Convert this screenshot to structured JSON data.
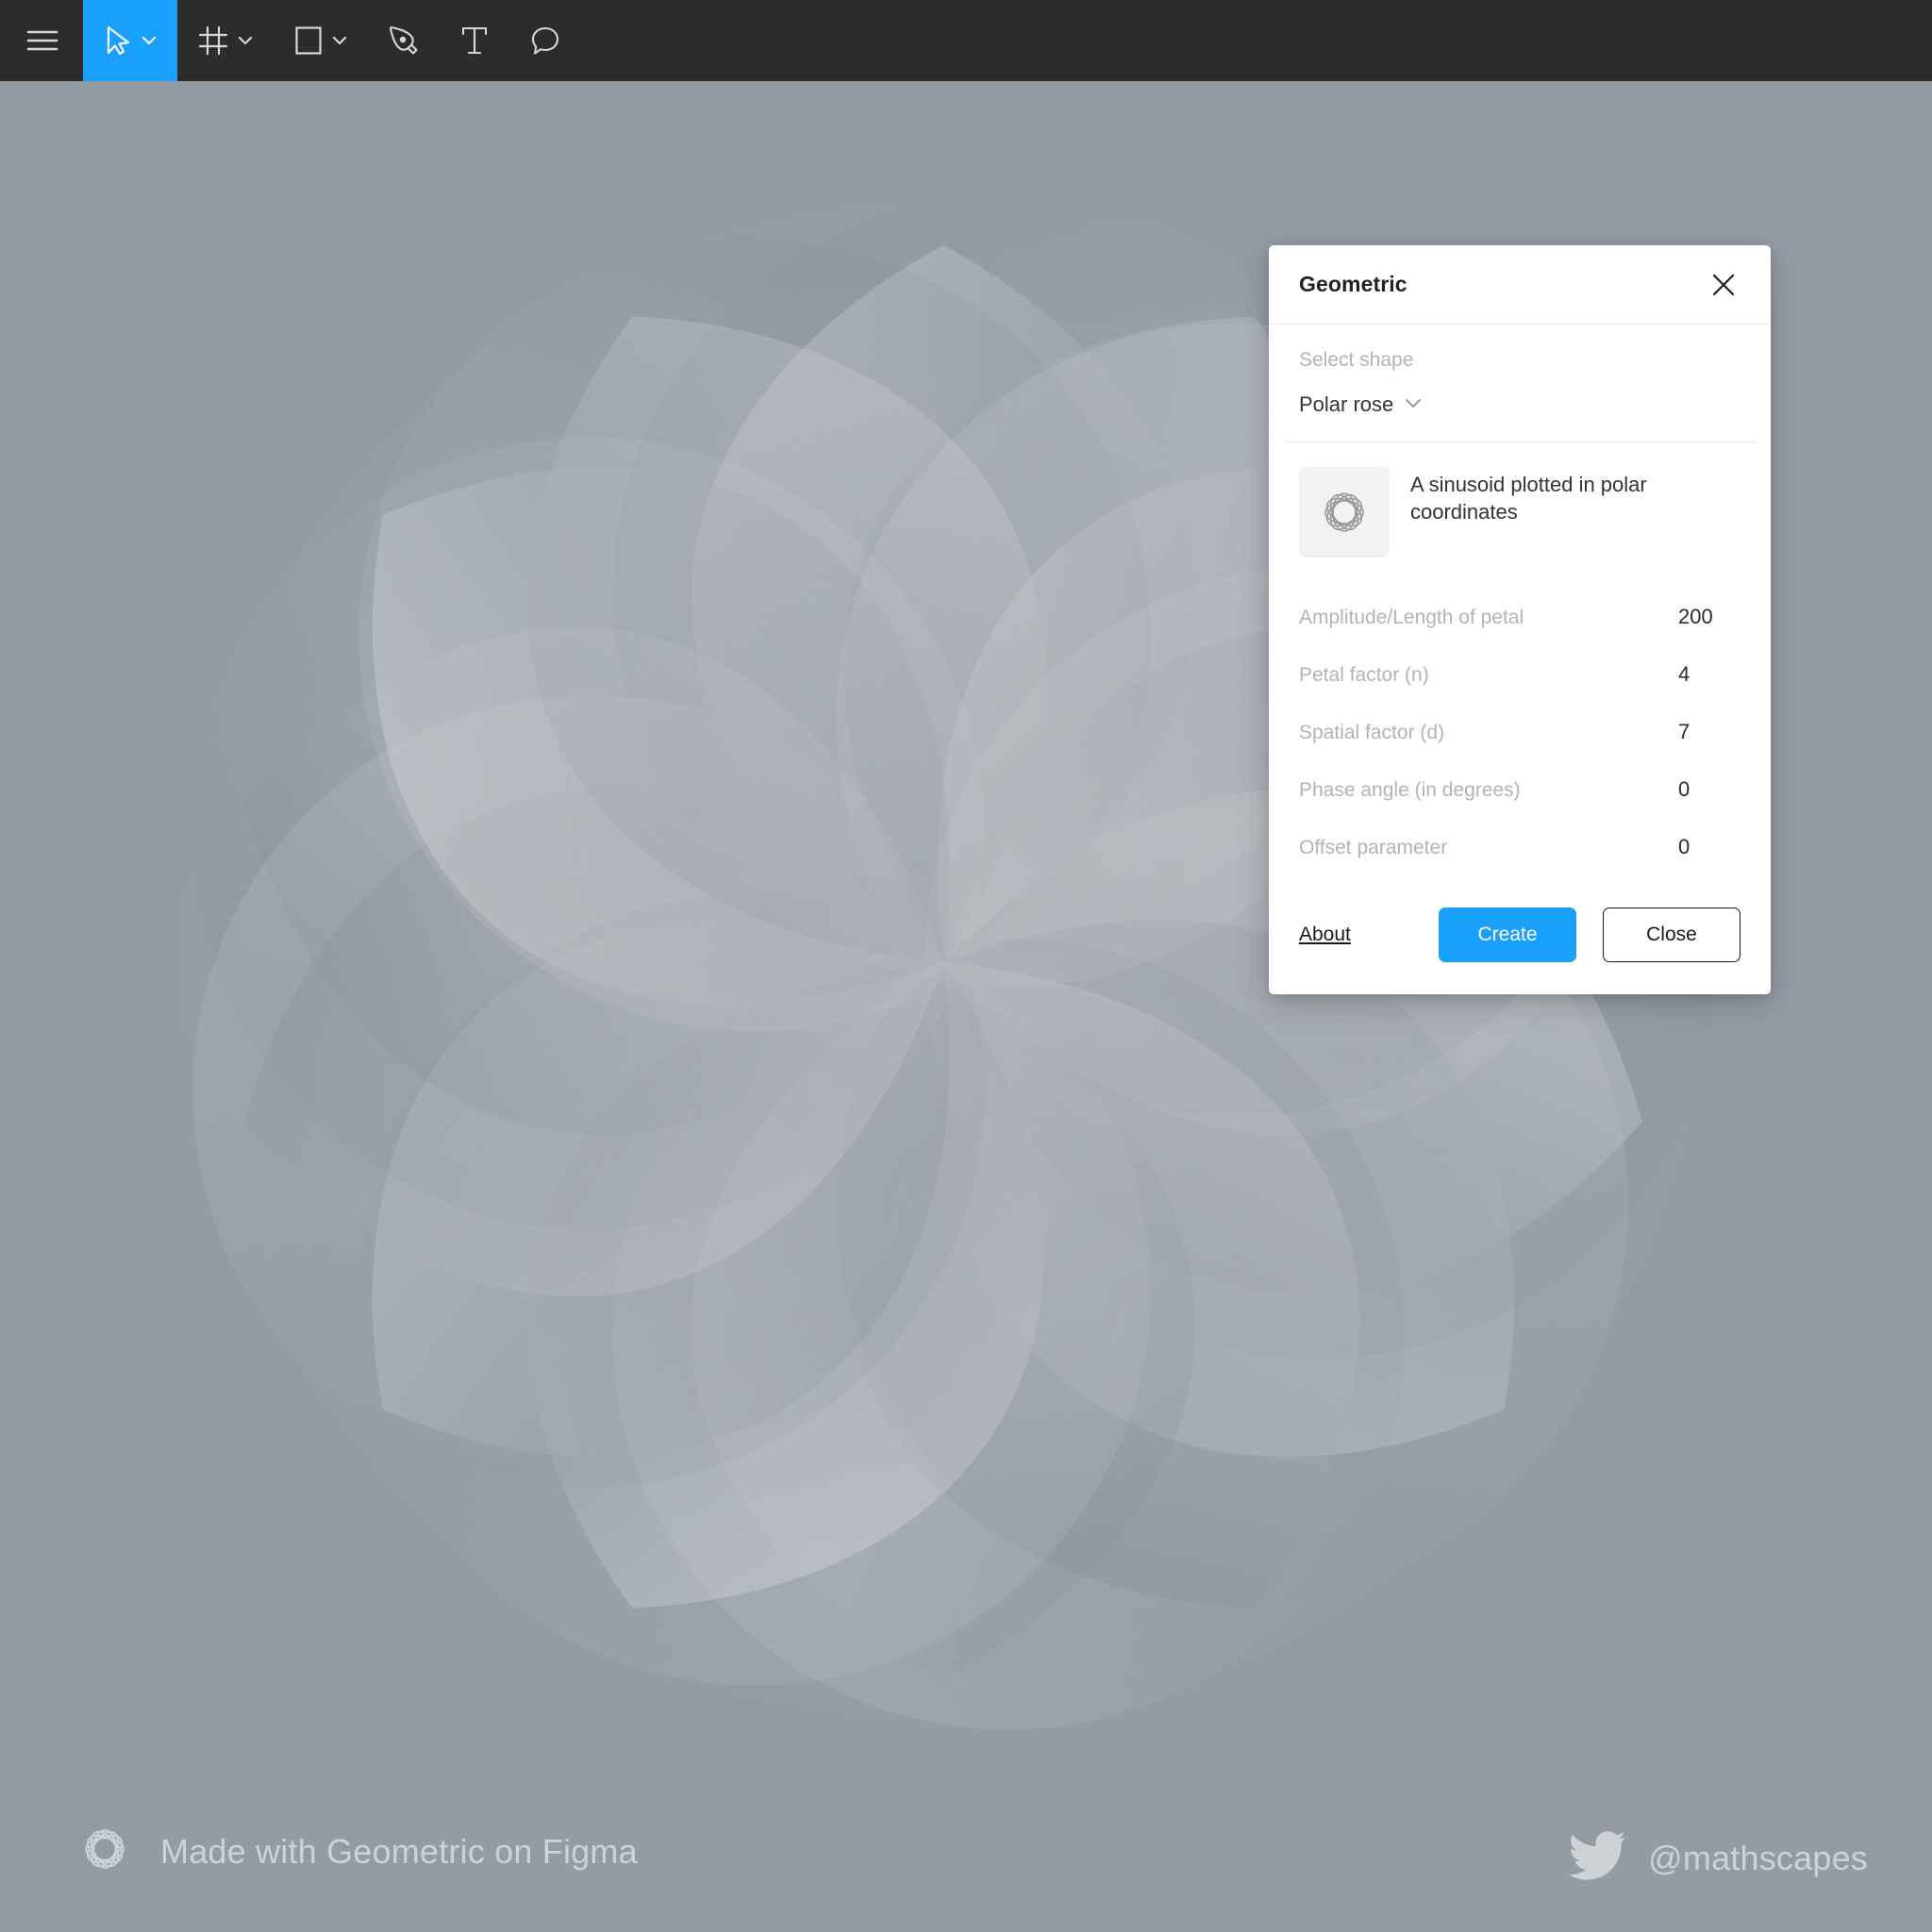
{
  "app": {
    "canvas_background": "#939ca5",
    "accent": "#18a0fb",
    "toolbar_background": "#2c2c2c"
  },
  "toolbar": {
    "items": [
      {
        "name": "main-menu",
        "icon": "hamburger-menu-icon",
        "has_chevron": false,
        "active": false
      },
      {
        "name": "move-tool",
        "icon": "cursor-arrow-icon",
        "has_chevron": true,
        "active": true
      },
      {
        "name": "frame-tool",
        "icon": "frame-grid-icon",
        "has_chevron": true,
        "active": false
      },
      {
        "name": "shape-tool",
        "icon": "rectangle-icon",
        "has_chevron": true,
        "active": false
      },
      {
        "name": "pen-tool",
        "icon": "pen-nib-icon",
        "has_chevron": false,
        "active": false
      },
      {
        "name": "text-tool",
        "icon": "text-t-icon",
        "has_chevron": false,
        "active": false
      },
      {
        "name": "comment-tool",
        "icon": "comment-bubble-icon",
        "has_chevron": false,
        "active": false
      }
    ]
  },
  "dialog": {
    "title": "Geometric",
    "close_icon": "close-x-icon",
    "select_shape_label": "Select shape",
    "selected_shape": "Polar rose",
    "shape_chevron_icon": "chevron-down-icon",
    "preview_icon": "polar-rose-rosette-icon",
    "description": "A sinusoid plotted in polar coordinates",
    "parameters": [
      {
        "label": "Amplitude/Length of petal",
        "value": "200"
      },
      {
        "label": "Petal factor (n)",
        "value": "4"
      },
      {
        "label": "Spatial factor (d)",
        "value": "7"
      },
      {
        "label": "Phase angle (in degrees)",
        "value": "0"
      },
      {
        "label": "Offset parameter",
        "value": "0"
      }
    ],
    "footer": {
      "about_label": "About",
      "create_label": "Create",
      "close_label": "Close"
    }
  },
  "watermarks": {
    "left": {
      "icon": "geometric-rosette-logo-icon",
      "text": "Made with Geometric on Figma"
    },
    "right": {
      "icon": "twitter-bird-icon",
      "text": "@mathscapes"
    }
  },
  "artwork": {
    "type": "polar-rose",
    "amplitude": 200,
    "petal_factor_n": 4,
    "spatial_factor_d": 7,
    "phase_angle_deg": 0,
    "offset": 0
  }
}
